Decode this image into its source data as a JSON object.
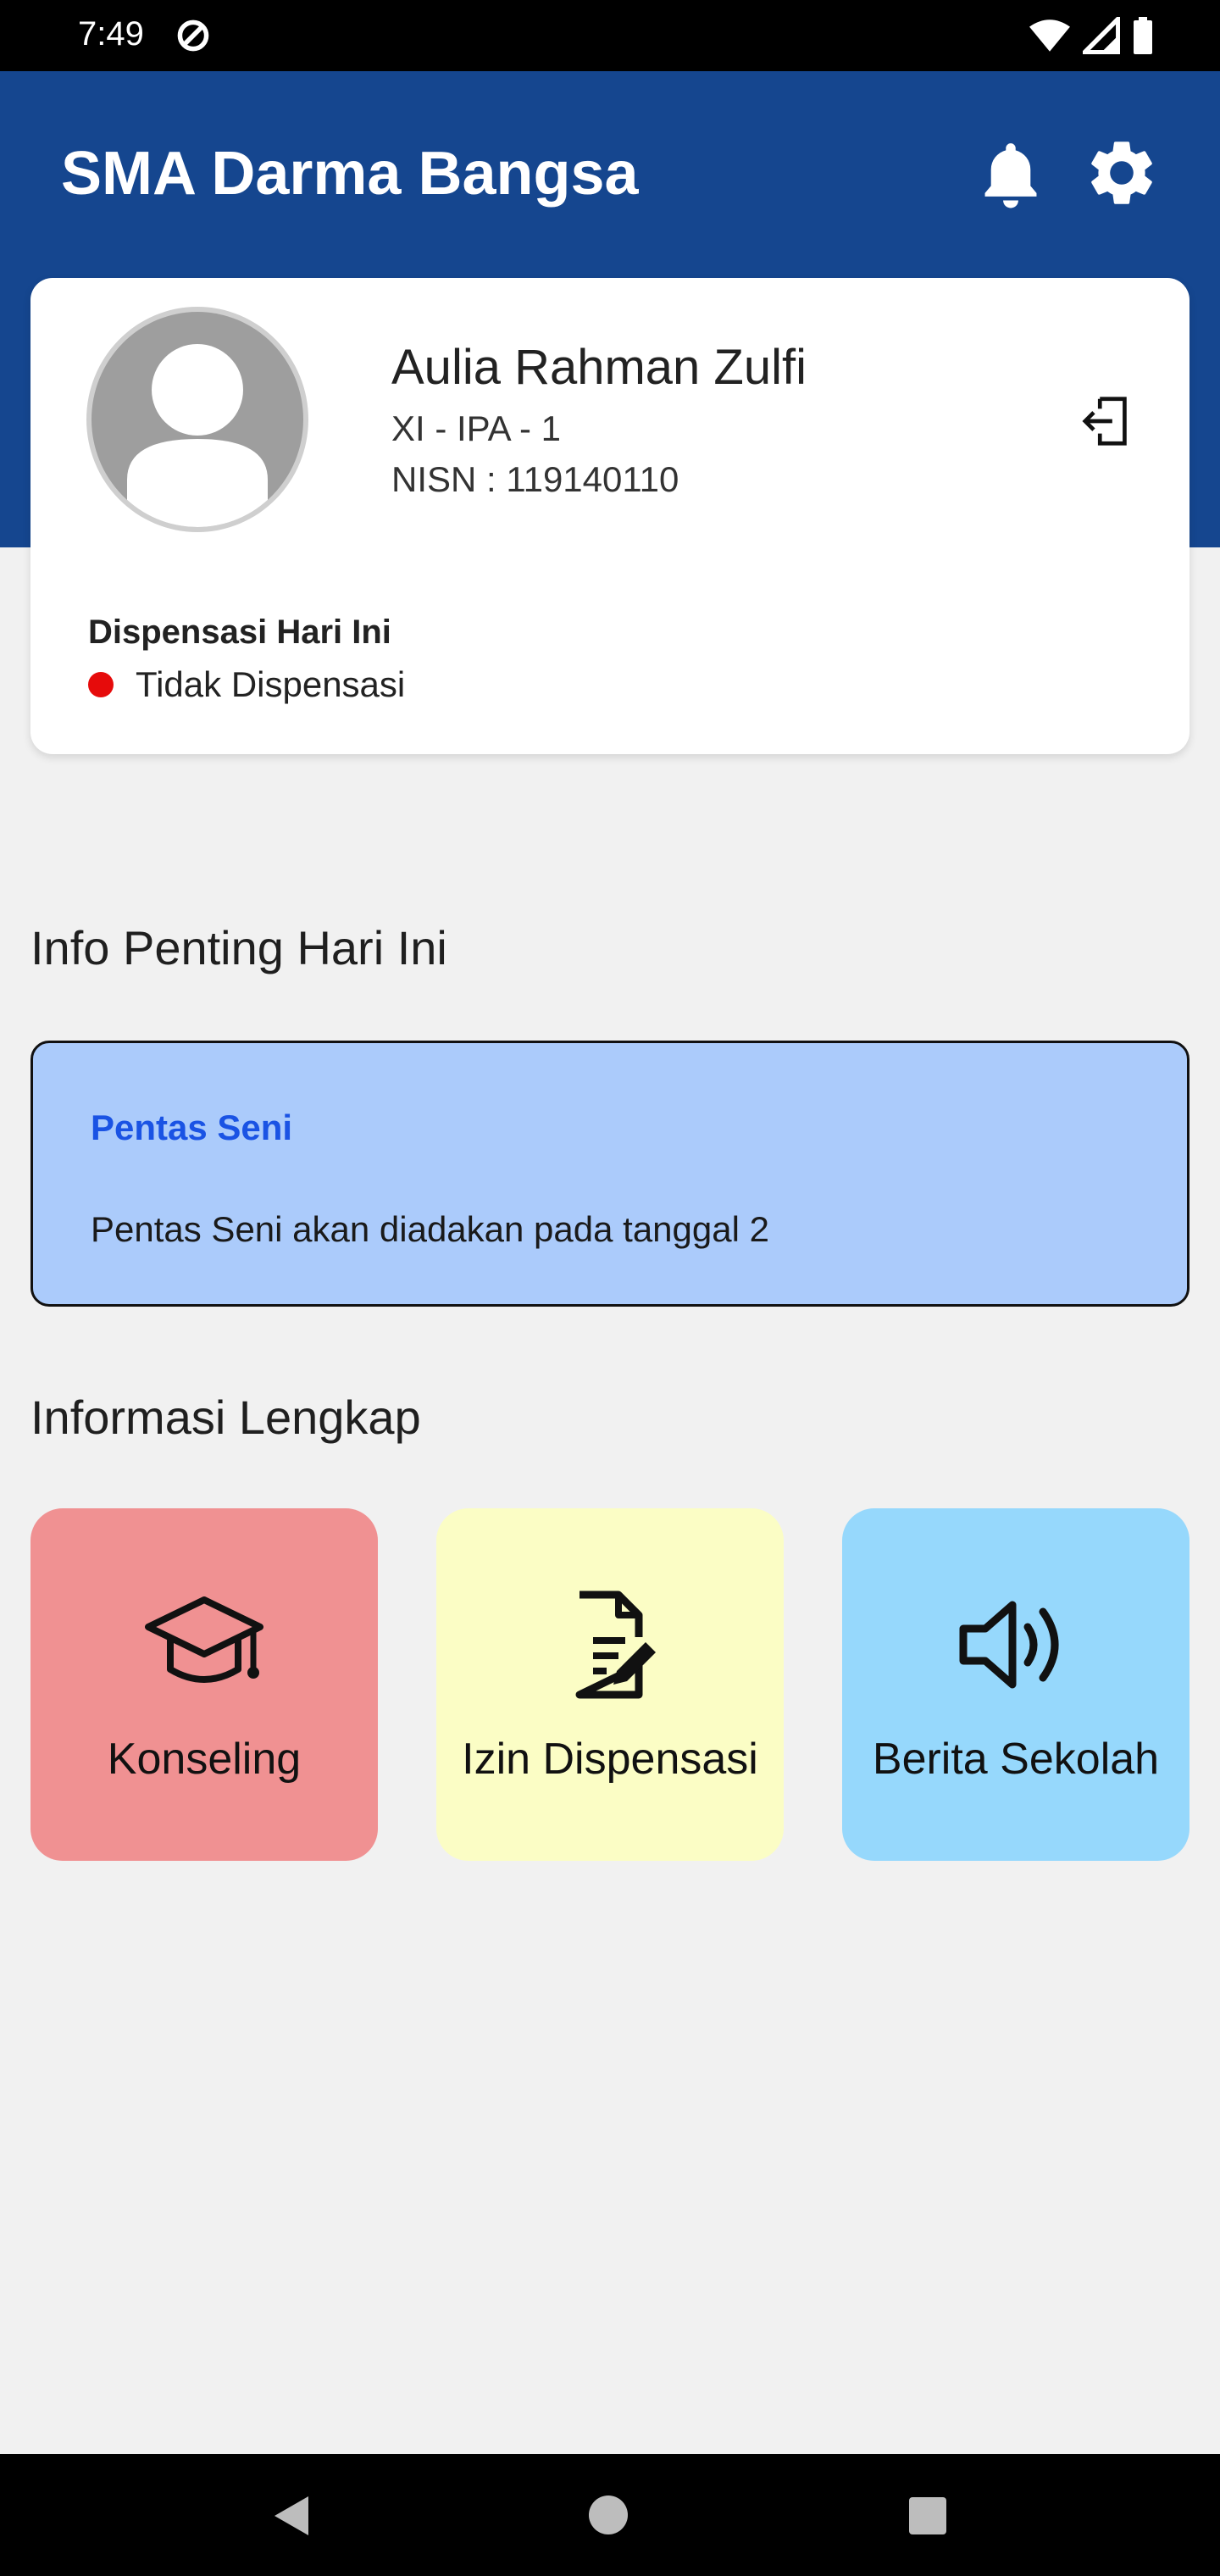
{
  "status_bar": {
    "time": "7:49"
  },
  "app_bar": {
    "title": "SMA Darma Bangsa"
  },
  "profile": {
    "name": "Aulia Rahman Zulfi",
    "class": "XI - IPA - 1",
    "nisn": "NISN : 119140110",
    "dispensation_label": "Dispensasi Hari Ini",
    "dispensation_status": "Tidak Dispensasi",
    "status_color": "#e60b0b"
  },
  "sections": {
    "info_title": "Info Penting Hari Ini",
    "full_info_title": "Informasi Lengkap"
  },
  "info_card": {
    "title": "Pentas Seni",
    "text": "Pentas Seni akan diadakan pada tanggal 2"
  },
  "menu": [
    {
      "label": "Konseling",
      "icon": "graduation-cap-icon",
      "color": "#f09192"
    },
    {
      "label": "Izin Dispensasi",
      "icon": "document-edit-icon",
      "color": "#fbfdc5"
    },
    {
      "label": "Berita Sekolah",
      "icon": "speaker-icon",
      "color": "#96d8fc"
    }
  ],
  "colors": {
    "app_bar": "#15468f",
    "background": "#f1f1f1",
    "info_card": "#abcbfb",
    "info_title": "#1a53e4"
  }
}
